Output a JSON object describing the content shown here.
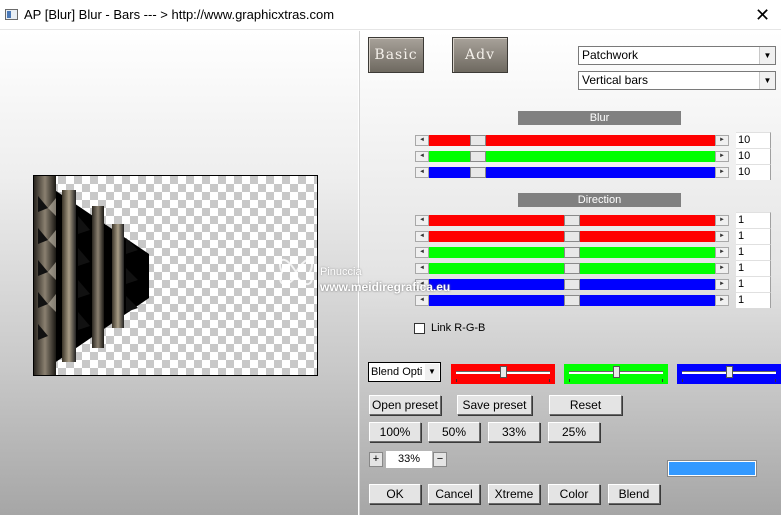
{
  "window": {
    "title": "AP [Blur]  Blur - Bars   --- > http://www.graphicxtras.com",
    "close_glyph": "✕"
  },
  "tabs": {
    "basic": "Basic",
    "adv": "Adv"
  },
  "dropdowns": {
    "category": "Patchwork",
    "effect": "Vertical bars"
  },
  "blur": {
    "title": "Blur",
    "sliders": [
      {
        "color": "#ff0000",
        "value": 0.15,
        "field": "10"
      },
      {
        "color": "#00ff00",
        "value": 0.15,
        "field": "10"
      },
      {
        "color": "#0000ff",
        "value": 0.15,
        "field": "10"
      }
    ]
  },
  "direction": {
    "title": "Direction",
    "sliders": [
      {
        "color": "#ff0000",
        "value": 0.5,
        "field": "1"
      },
      {
        "color": "#ff0000",
        "value": 0.5,
        "field": "1"
      },
      {
        "color": "#00ff00",
        "value": 0.5,
        "field": "1"
      },
      {
        "color": "#00ff00",
        "value": 0.5,
        "field": "1"
      },
      {
        "color": "#0000ff",
        "value": 0.5,
        "field": "1"
      },
      {
        "color": "#0000ff",
        "value": 0.5,
        "field": "1"
      }
    ]
  },
  "link_rgb": {
    "label": "Link R-G-B",
    "checked": false
  },
  "blend": {
    "select_value": "Blend Opti",
    "sliders": [
      {
        "color": "#ff0000",
        "value": 0.5
      },
      {
        "color": "#00ff00",
        "value": 0.5
      },
      {
        "color": "#0000ff",
        "value": 0.5
      }
    ]
  },
  "presets": {
    "open": "Open preset",
    "save": "Save preset",
    "reset": "Reset"
  },
  "zoom_buttons": [
    "100%",
    "50%",
    "33%",
    "25%"
  ],
  "zoom": {
    "plus": "+",
    "value": "33%",
    "minus": "−"
  },
  "swatch_color": "#3399ff",
  "actions": {
    "ok": "OK",
    "cancel": "Cancel",
    "xtreme": "Xtreme",
    "color": "Color",
    "blend": "Blend"
  },
  "watermark": {
    "line1": "Pinuccia",
    "line2": "www.meidiregrafica.eu"
  }
}
